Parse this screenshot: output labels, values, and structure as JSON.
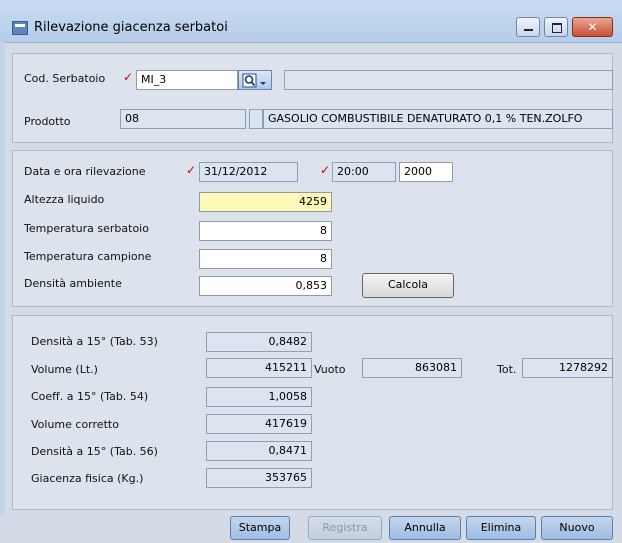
{
  "window": {
    "title": "Rilevazione giacenza serbatoi",
    "close_glyph": "✕"
  },
  "top": {
    "cod_label": "Cod. Serbatoio",
    "cod_value": "MI_3",
    "cod_desc": "",
    "prodotto_label": "Prodotto",
    "prodotto_code": "08",
    "prodotto_blank": "",
    "prodotto_desc": "GASOLIO COMBUSTIBILE DENATURATO 0,1 % TEN.ZOLFO",
    "lookup_icon": "search-dropdown-icon"
  },
  "middle": {
    "data_label": "Data e ora rilevazione",
    "data_value": "31/12/2012",
    "ora_value": "20:00",
    "year_value": "2000",
    "altezza_label": "Altezza liquido",
    "altezza_value": "4259",
    "temp_serb_label": "Temperatura serbatoio",
    "temp_serb_value": "8",
    "temp_camp_label": "Temperatura campione",
    "temp_camp_value": "8",
    "densita_label": "Densità ambiente",
    "densita_value": "0,853",
    "calcola_label": "Calcola"
  },
  "results": {
    "dens53_label": "Densità a 15° (Tab. 53)",
    "dens53_value": "0,8482",
    "volume_label": "Volume (Lt.)",
    "volume_value": "415211",
    "vuoto_label": "Vuoto",
    "vuoto_value": "863081",
    "tot_label": "Tot.",
    "tot_value": "1278292",
    "coeff_label": "Coeff. a 15° (Tab. 54)",
    "coeff_value": "1,0058",
    "volcorr_label": "Volume corretto",
    "volcorr_value": "417619",
    "dens56_label": "Densità a 15° (Tab. 56)",
    "dens56_value": "0,8471",
    "giacenza_label": "Giacenza fisica (Kg.)",
    "giacenza_value": "353765"
  },
  "buttons": {
    "stampa": "Stampa",
    "registra": "Registra",
    "annulla": "Annulla",
    "elimina": "Elimina",
    "nuovo": "Nuovo"
  },
  "colors": {
    "required_mark": "#cc0000",
    "highlight_field": "#fdf8b6"
  }
}
